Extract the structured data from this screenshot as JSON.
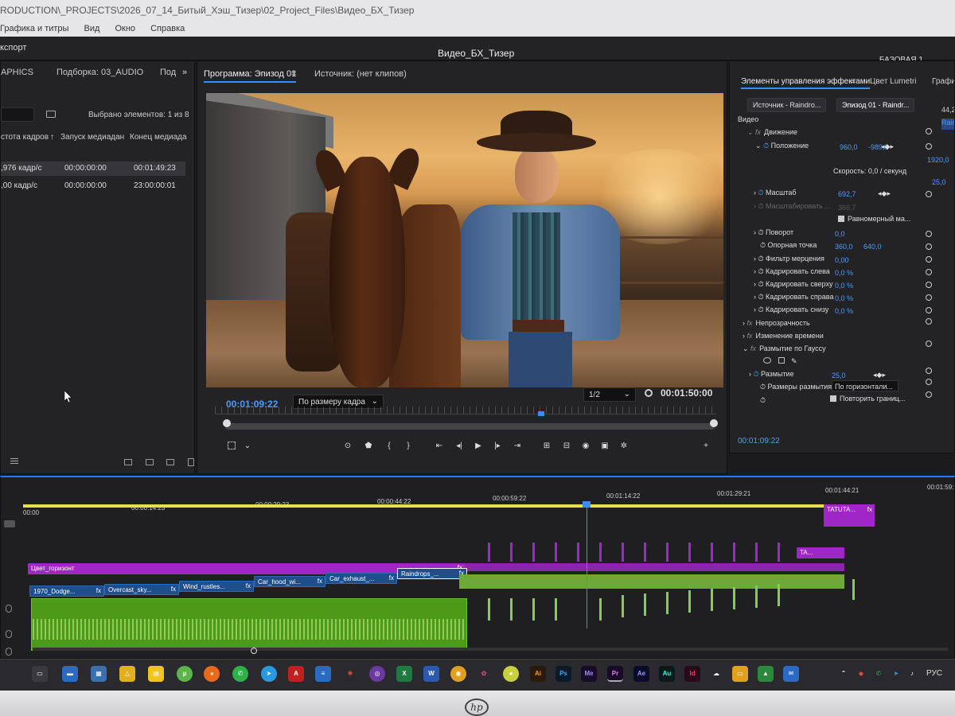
{
  "window": {
    "path": "RODUCTION\\_PROJECTS\\2026_07_14_Битый_Хэш_Тизер\\02_Project_Files\\Видео_БХ_Тизер",
    "menus": [
      "Графика и титры",
      "Вид",
      "Окно",
      "Справка"
    ],
    "export_label": "кспорт",
    "project_title": "Видео_БХ_Тизер",
    "workspace": "БАЗОВАЯ 1"
  },
  "project": {
    "tabs": [
      "APHICS",
      "Подборка: 03_AUDIO",
      "Под"
    ],
    "selected": "Выбрано элементов: 1 из 8",
    "headers": [
      "стота кадров",
      "Запуск медиадан",
      "Конец медиада"
    ],
    "rows": [
      {
        "fps": ",976 кадр/с",
        "start": "00:00:00:00",
        "end": "00:01:49:23"
      },
      {
        "fps": ",00 кадр/с",
        "start": "00:00:00:00",
        "end": "23:00:00:01"
      }
    ]
  },
  "program": {
    "tab_program": "Программа: Эпизод 01",
    "tab_source": "Источник: (нет клипов)",
    "timecode_current": "00:01:09:22",
    "fit": "По размеру кадра",
    "resolution": "1/2",
    "timecode_duration": "00:01:50:00"
  },
  "effects": {
    "tabs": [
      "Элементы управления эффектами",
      "Цвет Lumetri",
      "Графи"
    ],
    "source_pill": "Источник - Raindro...",
    "sequence_pill": "Эпизод 01 - Raindr...",
    "section_video": "Видео",
    "motion": "Движение",
    "position_label": "Положение",
    "position_x": "960,0",
    "position_y": "-989,0",
    "speed": "Скорость: 0,0 / секунд",
    "right_value": "1920,0",
    "right_value2": "25,0",
    "scale_label": "Масштаб",
    "scale_value": "692,7",
    "scale_width_label": "Масштабировать ...",
    "scale_width_value": "366,7",
    "uniform_label": "Равномерный ма...",
    "rotation_label": "Поворот",
    "rotation_value": "0,0",
    "anchor_label": "Опорная точка",
    "anchor_x": "360,0",
    "anchor_y": "640,0",
    "flicker_label": "Фильтр мерцения",
    "flicker_value": "0,00",
    "crop_left_label": "Кадрировать слева",
    "crop_left_value": "0,0 %",
    "crop_top_label": "Кадрировать сверху",
    "crop_top_value": "0,0 %",
    "crop_right_label": "Кадрировать справа",
    "crop_right_value": "0,0 %",
    "crop_bottom_label": "Кадрировать снизу",
    "crop_bottom_value": "0,0 %",
    "opacity": "Непрозрачность",
    "time_remap": "Изменение времени",
    "gaussian": "Размытие по Гауссу",
    "blur_label": "Размытие",
    "blur_value": "25,0",
    "blur_dim_label": "Размеры размытия",
    "blur_dim_value": "По горизонтали...",
    "repeat_edges": "Повторить границ...",
    "timecode": "00:01:09:22",
    "top_right_value": "44,2",
    "top_right_label": "Raine"
  },
  "timeline": {
    "ruler": [
      "00:00",
      "00:00:14:23",
      "00:00:29:23",
      "00:00:44:22",
      "00:00:59:22",
      "00:01:14:22",
      "00:01:29:21",
      "00:01:44:21",
      "00:01:59:2"
    ],
    "clip_title": "TATUTA...",
    "clip_color": "Цвет_горизонт",
    "clip_ta": "TA...",
    "video_clips": [
      "1970_Dodge...",
      "Overcast_sky...",
      "Wind_rustles...",
      "Car_hood_wi...",
      "Car_exhaust_...",
      "Raindrops_..."
    ],
    "fx_label": "fx"
  },
  "taskbar": {
    "apps": [
      "Ai",
      "Ps",
      "Me",
      "Pr",
      "Ae",
      "Au",
      "Id"
    ],
    "lang": "РУС"
  },
  "bezel": {
    "brand": "hp"
  }
}
